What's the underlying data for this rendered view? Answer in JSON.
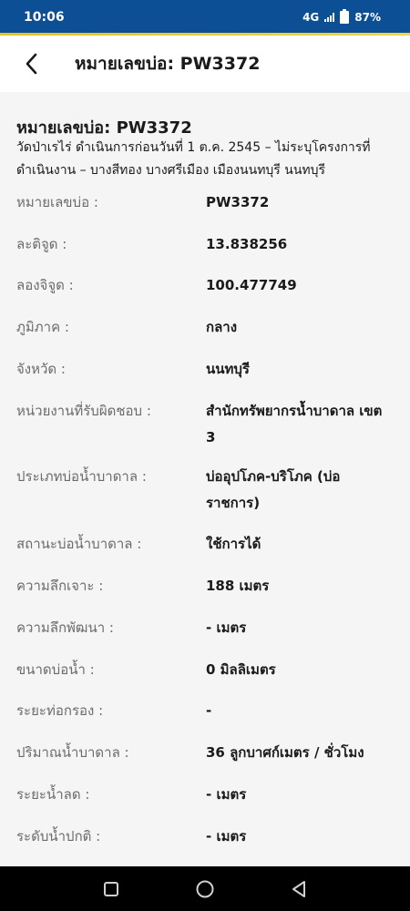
{
  "status_bar": {
    "time": "10:06",
    "network": "4G",
    "battery": "87%"
  },
  "app_bar": {
    "title": "หมายเลขบ่อ: PW3372",
    "back_icon": "chevron-left-icon"
  },
  "record": {
    "title": "หมายเลขบ่อ: PW3372",
    "subtitle": "วัดป่าเรไร่ ดำเนินการก่อนวันที่ 1 ต.ค. 2545 – ไม่ระบุโครงการที่ดำเนินงาน – บางสีทอง บางศรีเมือง เมืองนนทบุรี นนทบุรี",
    "fields": [
      {
        "label": "หมายเลขบ่อ :",
        "value": "PW3372"
      },
      {
        "label": "ละติจูด :",
        "value": "13.838256"
      },
      {
        "label": "ลองจิจูด :",
        "value": "100.477749"
      },
      {
        "label": "ภูมิภาค :",
        "value": "กลาง"
      },
      {
        "label": "จังหวัด :",
        "value": "นนทบุรี"
      },
      {
        "label": "หน่วยงานที่รับผิดชอบ :",
        "value": "สำนักทรัพยากรน้ำบาดาล เขต 3"
      },
      {
        "label": "ประเภทบ่อน้ำบาดาล :",
        "value": "บ่ออุปโภค-บริโภค (บ่อราชการ)"
      },
      {
        "label": "สถานะบ่อน้ำบาดาล :",
        "value": "ใช้การได้"
      },
      {
        "label": "ความลึกเจาะ :",
        "value": "188 เมตร"
      },
      {
        "label": "ความลึกพัฒนา :",
        "value": "- เมตร"
      },
      {
        "label": "ขนาดบ่อน้ำ :",
        "value": "0 มิลลิเมตร"
      },
      {
        "label": "ระยะท่อกรอง :",
        "value": "-"
      },
      {
        "label": "ปริมาณน้ำบาดาล :",
        "value": "36 ลูกบาศก์เมตร / ชั่วโมง"
      },
      {
        "label": "ระยะน้ำลด :",
        "value": "- เมตร"
      },
      {
        "label": "ระดับน้ำปกติ :",
        "value": "- เมตร"
      }
    ]
  },
  "nav_bar": {
    "recents_icon": "square-recents-icon",
    "home_icon": "circle-home-icon",
    "back_icon": "triangle-back-icon"
  },
  "colors": {
    "status_bar_bg": "#0d4f95",
    "accent_stripe": "#e8c12a",
    "content_bg": "#f5f5f5",
    "label": "#6b6b6b",
    "value": "#1a1a1a"
  }
}
